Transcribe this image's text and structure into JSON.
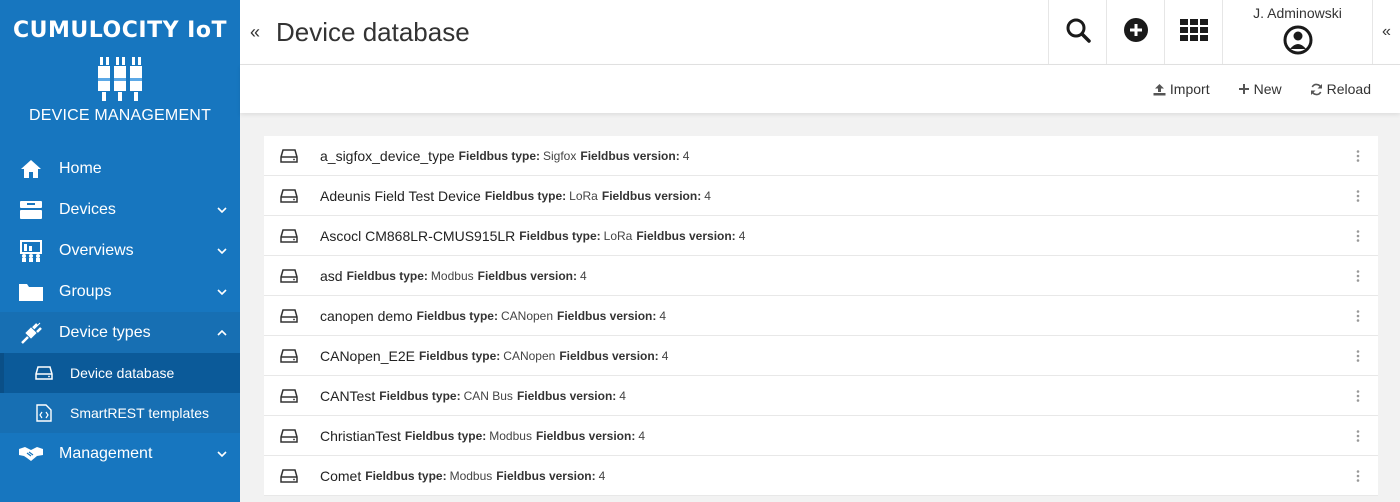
{
  "brand": {
    "title": "CUMULOCITY IoT",
    "subtitle": "DEVICE MANAGEMENT"
  },
  "sidebar": {
    "items": [
      {
        "label": "Home",
        "icon": "home-icon"
      },
      {
        "label": "Devices",
        "icon": "devices-icon"
      },
      {
        "label": "Overviews",
        "icon": "overviews-icon"
      },
      {
        "label": "Groups",
        "icon": "folder-icon"
      },
      {
        "label": "Device types",
        "icon": "plug-icon"
      },
      {
        "label": "Management",
        "icon": "handshake-icon"
      }
    ],
    "subitems": [
      {
        "label": "Device database",
        "icon": "hdd-icon",
        "active": true
      },
      {
        "label": "SmartREST templates",
        "icon": "code-file-icon",
        "active": false
      }
    ]
  },
  "header": {
    "title": "Device database",
    "user_name": "J. Adminowski",
    "collapse_left": "«",
    "collapse_right": "«"
  },
  "actions": {
    "import": "Import",
    "new": "New",
    "reload": "Reload"
  },
  "rows": [
    {
      "name": "a_sigfox_device_type",
      "type_label": "Fieldbus type:",
      "type": "Sigfox",
      "version_label": "Fieldbus version:",
      "version": "4"
    },
    {
      "name": "Adeunis Field Test Device",
      "type_label": "Fieldbus type:",
      "type": "LoRa",
      "version_label": "Fieldbus version:",
      "version": "4"
    },
    {
      "name": "Ascocl CM868LR-CMUS915LR",
      "type_label": "Fieldbus type:",
      "type": "LoRa",
      "version_label": "Fieldbus version:",
      "version": "4"
    },
    {
      "name": "asd",
      "type_label": "Fieldbus type:",
      "type": "Modbus",
      "version_label": "Fieldbus version:",
      "version": "4"
    },
    {
      "name": "canopen demo",
      "type_label": "Fieldbus type:",
      "type": "CANopen",
      "version_label": "Fieldbus version:",
      "version": "4"
    },
    {
      "name": "CANopen_E2E",
      "type_label": "Fieldbus type:",
      "type": "CANopen",
      "version_label": "Fieldbus version:",
      "version": "4"
    },
    {
      "name": "CANTest",
      "type_label": "Fieldbus type:",
      "type": "CAN Bus",
      "version_label": "Fieldbus version:",
      "version": "4"
    },
    {
      "name": "ChristianTest",
      "type_label": "Fieldbus type:",
      "type": "Modbus",
      "version_label": "Fieldbus version:",
      "version": "4"
    },
    {
      "name": "Comet",
      "type_label": "Fieldbus type:",
      "type": "Modbus",
      "version_label": "Fieldbus version:",
      "version": "4"
    }
  ],
  "colors": {
    "sidebar": "#1776bf",
    "sidebar_active": "#0b5a99",
    "text": "#333333"
  }
}
